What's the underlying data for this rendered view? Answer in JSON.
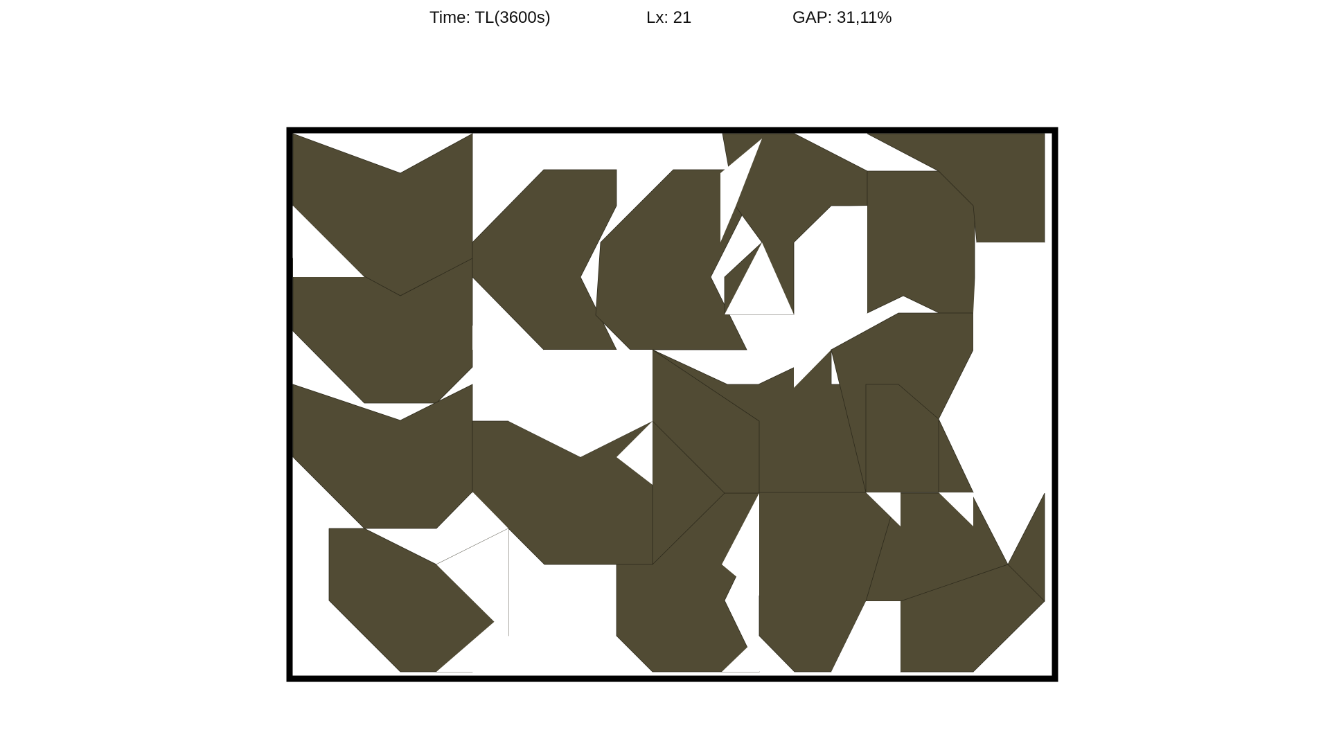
{
  "header": {
    "time": "Time: TL(3600s)",
    "lx": "Lx: 21",
    "gap": "GAP: 31,11%"
  },
  "colors": {
    "piece_fill": "#514b34",
    "piece_outline": "#2d2a1c",
    "container_border": "#000000",
    "background": "#ffffff"
  }
}
